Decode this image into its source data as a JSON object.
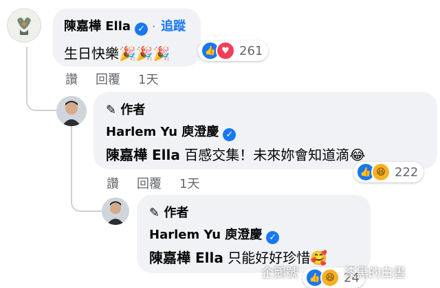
{
  "comment1": {
    "author": "陳嘉樺 Ella",
    "follow_label": "追蹤",
    "separator": "·",
    "text": "生日快樂",
    "emojis": "🎉🎉🎉",
    "reaction_count": "261",
    "actions": {
      "like": "讚",
      "reply": "回覆",
      "time": "1天"
    }
  },
  "reply1": {
    "author_badge": "作者",
    "author": "Harlem Yu 庾澄慶",
    "mention": "陳嘉樺 Ella",
    "text": "百感交集！未來妳會知道滴",
    "emoji": "😂",
    "reaction_count": "222",
    "actions": {
      "like": "讚",
      "reply": "回覆",
      "time": "1天"
    }
  },
  "reply2": {
    "author_badge": "作者",
    "author": "Harlem Yu 庾澄慶",
    "mention": "陳嘉樺 Ella",
    "text": "只能好好珍惜",
    "emoji": "🥰",
    "reaction_count": "24"
  },
  "watermark": {
    "left": "企鵝號",
    "right": "漆黑的白晝"
  },
  "icons": [
    "verified-icon",
    "pencil-icon",
    "like-reaction-icon",
    "love-reaction-icon",
    "haha-reaction-icon"
  ],
  "colors": {
    "accent": "#1877f2",
    "bubble": "#f0f2f5",
    "secondary_text": "#65676b"
  }
}
